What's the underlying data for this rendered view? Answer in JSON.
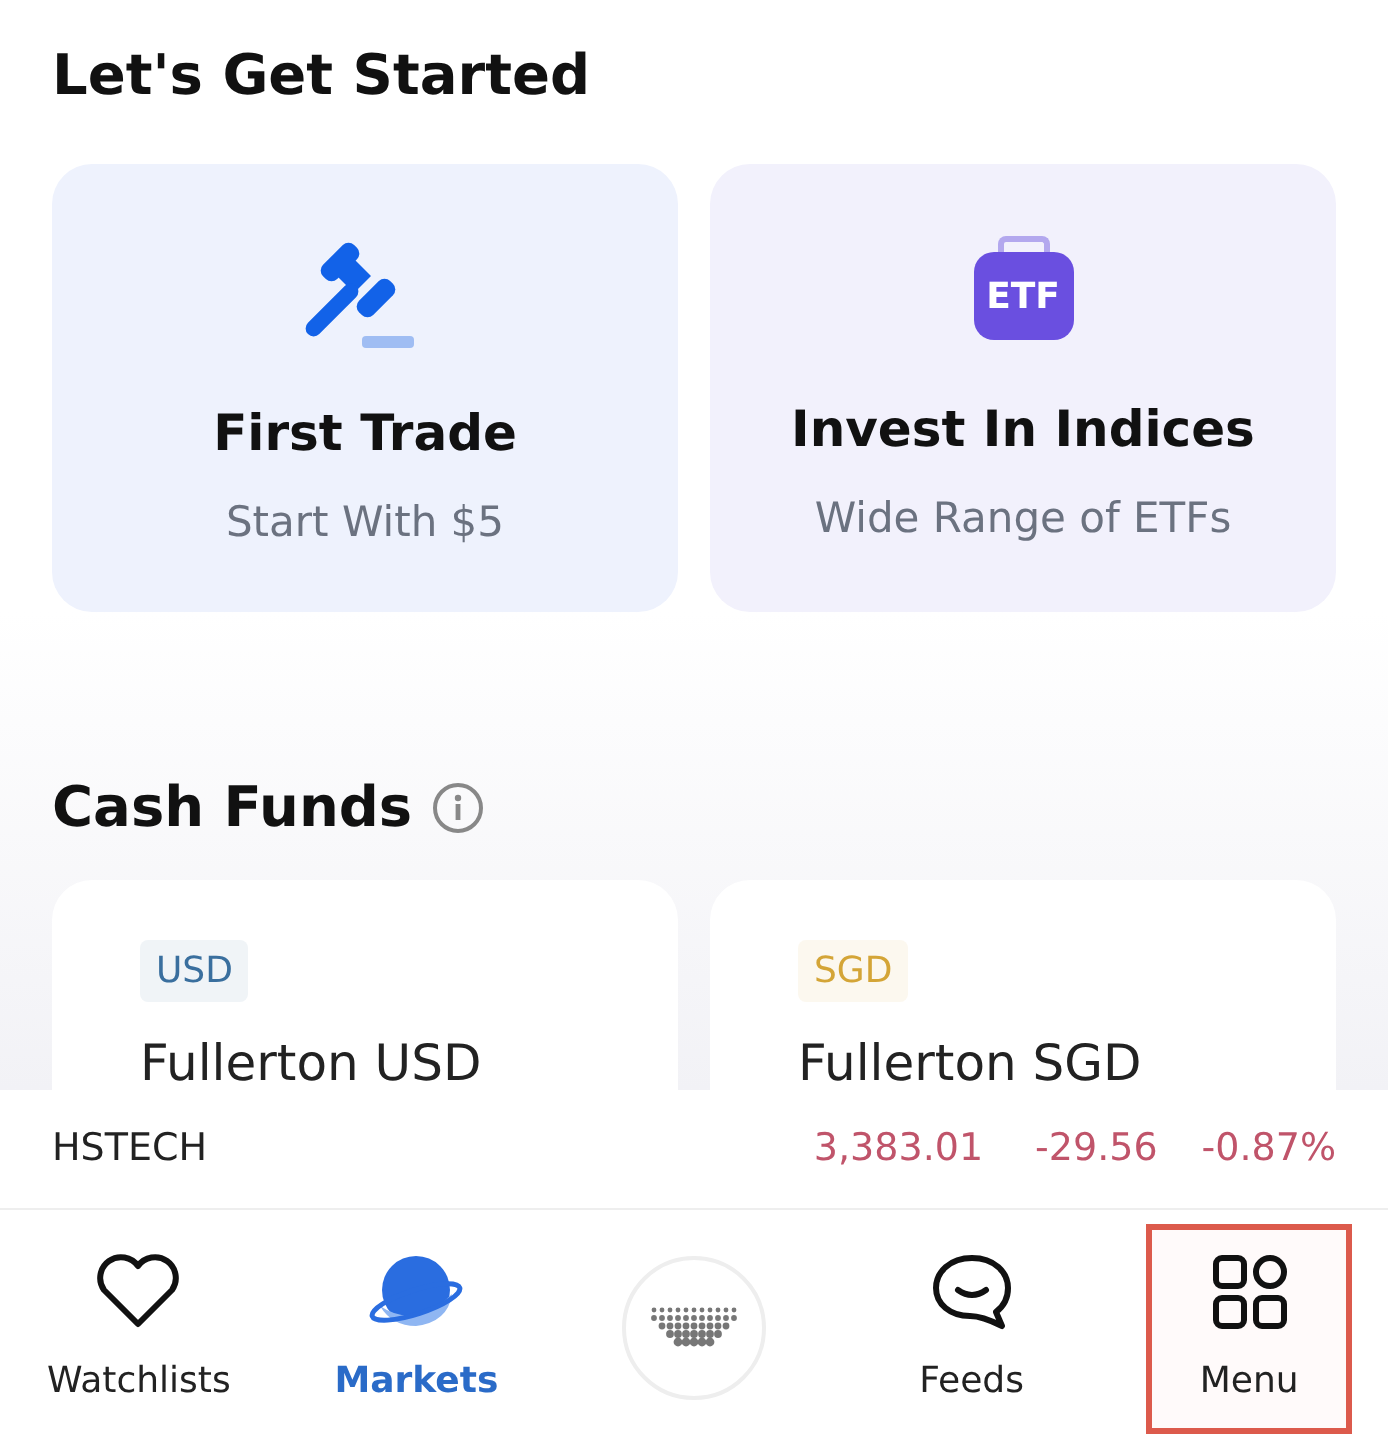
{
  "get_started": {
    "title": "Let's Get Started",
    "cards": [
      {
        "kind": "gavel",
        "title": "First Trade",
        "subtitle": "Start With $5"
      },
      {
        "kind": "etf",
        "title": "Invest In Indices",
        "subtitle": "Wide Range of ETFs",
        "icon_text": "ETF"
      }
    ]
  },
  "cash_funds": {
    "title": "Cash Funds",
    "funds": [
      {
        "currency": "USD",
        "color": "#3a6f9e",
        "name": "Fullerton USD"
      },
      {
        "currency": "SGD",
        "color": "#d4a537",
        "name": "Fullerton SGD"
      }
    ]
  },
  "ticker": {
    "symbol": "HSTECH",
    "price": "3,383.01",
    "change": "-29.56",
    "percent": "-0.87%"
  },
  "nav": [
    {
      "kind": "heart",
      "label": "Watchlists",
      "selected": false,
      "highlighted": false
    },
    {
      "kind": "planet",
      "label": "Markets",
      "selected": true,
      "highlighted": false
    },
    {
      "kind": "orb",
      "selected": false,
      "highlighted": false
    },
    {
      "kind": "chat",
      "label": "Feeds",
      "selected": false,
      "highlighted": false
    },
    {
      "kind": "grid",
      "label": "Menu",
      "selected": false,
      "highlighted": true
    }
  ]
}
